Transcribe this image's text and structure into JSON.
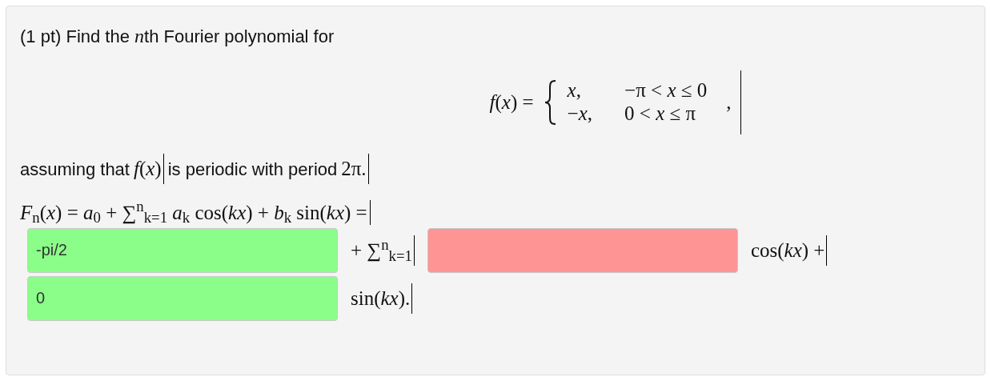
{
  "problem": {
    "points": "(1 pt)",
    "prompt_before": "Find the",
    "prompt_variable": "n",
    "prompt_after": "th Fourier polynomial for",
    "definition": {
      "lhs": "*f*(*x*) =",
      "cases": [
        {
          "expr": "*x*,",
          "cond": "−π < *x* ≤ 0"
        },
        {
          "expr": "−*x*,",
          "cond": "0 < *x* ≤ π"
        }
      ],
      "trail": ","
    },
    "assumption_prefix": "assuming that",
    "assumption_math": "*f*(*x*)",
    "assumption_middle": "is periodic with period",
    "assumption_period": "2π.",
    "formula": "*F*$_{n}$(*x*) = *a*$_{0}$ + ∑$^{n}$$_{k=1}$ *a*$_{k}$ cos(*kx*) + *b*$_{k}$ sin(*kx*) =",
    "answer_rows": [
      [
        {
          "kind": "field",
          "value": "-pi/2",
          "correct": true
        },
        {
          "kind": "text",
          "text": "+ ∑$^{n}$$_{k=1}$"
        },
        {
          "kind": "field",
          "correct": false
        },
        {
          "kind": "text",
          "text": "cos(*kx*) +"
        }
      ],
      [
        {
          "kind": "field",
          "value": "0",
          "correct": true
        },
        {
          "kind": "text",
          "text": "sin(*kx*)."
        }
      ]
    ]
  }
}
